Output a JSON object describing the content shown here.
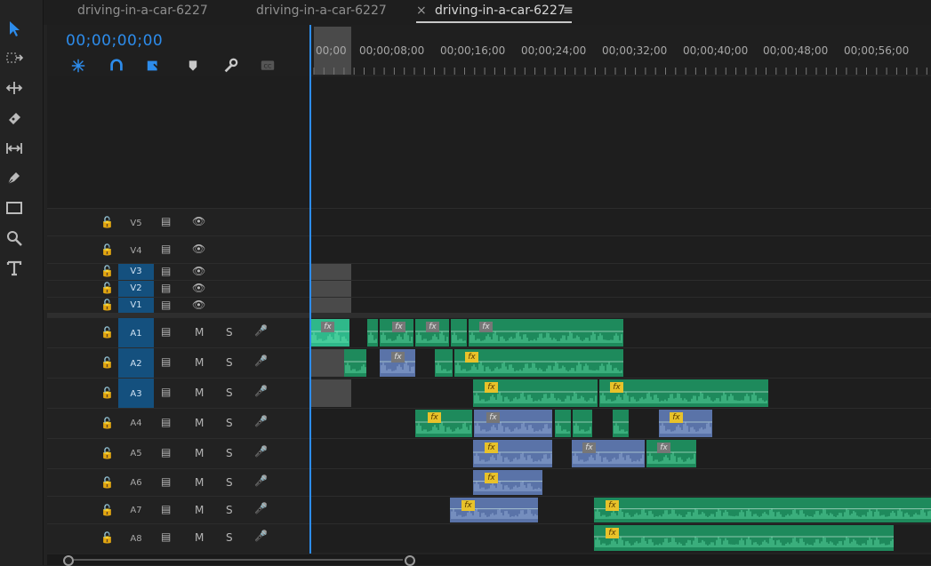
{
  "tabs": [
    {
      "label": "driving-in-a-car-6227",
      "active": false
    },
    {
      "label": "driving-in-a-car-6227",
      "active": false
    },
    {
      "label": "driving-in-a-car-6227",
      "active": true
    }
  ],
  "tab_close_glyph": "×",
  "tab_menu_glyph": "≡",
  "timecode": "00;00;00;00",
  "ruler": {
    "labels": [
      "00;00",
      "00;00;08;00",
      "00;00;16;00",
      "00;00;24;00",
      "00;00;32;00",
      "00;00;40;00",
      "00;00;48;00",
      "00;00;56;00"
    ]
  },
  "tools": [
    "selection-tool-icon",
    "track-select-tool-icon",
    "ripple-edit-tool-icon",
    "razor-tool-icon",
    "slip-tool-icon",
    "pen-tool-icon",
    "rectangle-tool-icon",
    "zoom-tool-icon",
    "type-tool-icon"
  ],
  "header_icons": [
    "nest-sequence-icon",
    "snap-icon",
    "linked-selection-icon",
    "add-marker-icon",
    "timeline-settings-icon",
    "captions-icon"
  ],
  "video_tracks": [
    {
      "name": "V5",
      "targeted": false
    },
    {
      "name": "V4",
      "targeted": false
    },
    {
      "name": "V3",
      "targeted": true
    },
    {
      "name": "V2",
      "targeted": true
    },
    {
      "name": "V1",
      "targeted": true
    }
  ],
  "audio_tracks": [
    {
      "name": "A1",
      "targeted": true
    },
    {
      "name": "A2",
      "targeted": true
    },
    {
      "name": "A3",
      "targeted": true
    },
    {
      "name": "A4",
      "targeted": false
    },
    {
      "name": "A5",
      "targeted": false
    },
    {
      "name": "A6",
      "targeted": false
    },
    {
      "name": "A7",
      "targeted": false
    },
    {
      "name": "A8",
      "targeted": false
    }
  ],
  "mute_label": "M",
  "solo_label": "S",
  "fx_label": "fx",
  "colors": {
    "accent": "#2d8ceb",
    "clip_green": "#1e8a5c",
    "clip_blue": "#5a73a8",
    "fx_yellow": "#e8c22a",
    "target_blue": "#14507e"
  }
}
